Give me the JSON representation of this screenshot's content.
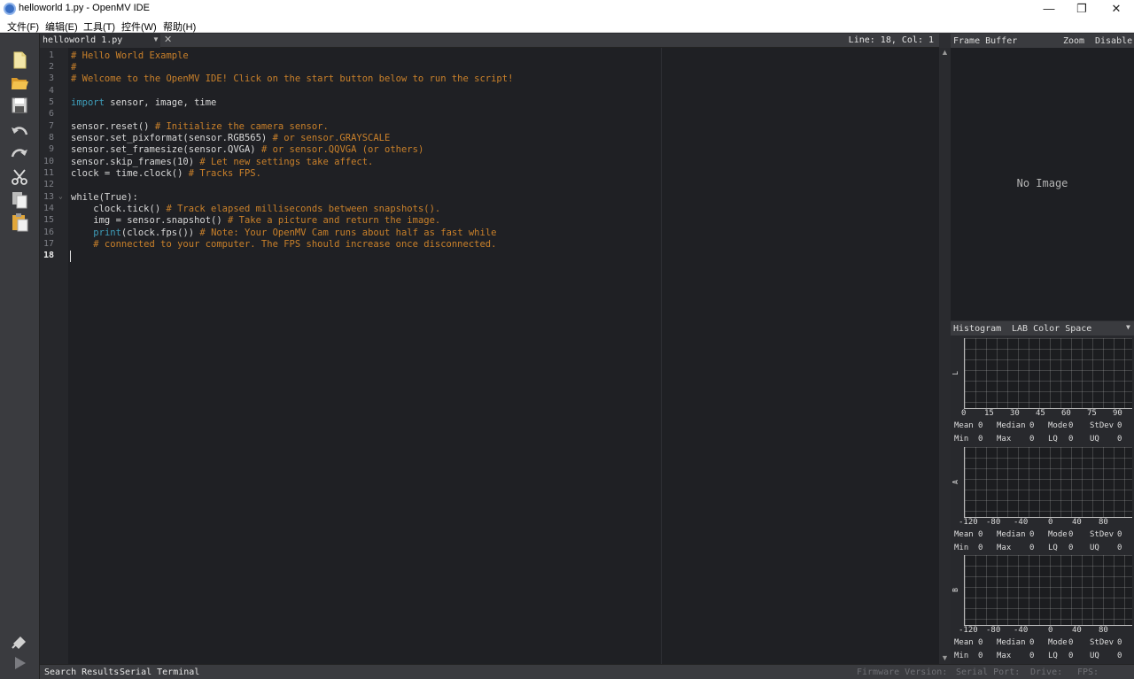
{
  "window": {
    "title": "helloworld 1.py - OpenMV IDE",
    "minimize": "—",
    "maximize": "❐",
    "close": "✕"
  },
  "menu": [
    "文件(F)",
    "编辑(E)",
    "工具(T)",
    "控件(W)",
    "帮助(H)"
  ],
  "editor": {
    "tab": {
      "label": "helloworld 1.py",
      "dropdown": "▼",
      "close": "✕"
    },
    "position": "Line: 18, Col: 1",
    "current_line": 18,
    "line_numbers": [
      "1",
      "2",
      "3",
      "4",
      "5",
      "6",
      "7",
      "8",
      "9",
      "10",
      "11",
      "12",
      "13",
      "14",
      "15",
      "16",
      "17",
      "18"
    ],
    "lines": {
      "l1": {
        "comment": "# Hello World Example"
      },
      "l2": {
        "comment": "#"
      },
      "l3": {
        "comment": "# Welcome to the OpenMV IDE! Click on the start button below to run the script!"
      },
      "l5": {
        "keyword": "import",
        "rest": " sensor, image, time"
      },
      "l7": {
        "code": "sensor.reset() ",
        "comment": "# Initialize the camera sensor."
      },
      "l8": {
        "code": "sensor.set_pixformat(sensor.RGB565) ",
        "comment": "# or sensor.GRAYSCALE"
      },
      "l9": {
        "code": "sensor.set_framesize(sensor.QVGA) ",
        "comment": "# or sensor.QQVGA (or others)"
      },
      "l10": {
        "code": "sensor.skip_frames(10) ",
        "comment": "# Let new settings take affect."
      },
      "l11": {
        "code": "clock = time.clock() ",
        "comment": "# Tracks FPS."
      },
      "l13": {
        "code": "while(True):"
      },
      "l14": {
        "code": "    clock.tick() ",
        "comment": "# Track elapsed milliseconds between snapshots()."
      },
      "l15": {
        "code": "    img = sensor.snapshot() ",
        "comment": "# Take a picture and return the image."
      },
      "l16": {
        "indent": "    ",
        "keyword": "print",
        "code": "(clock.fps()) ",
        "comment": "# Note: Your OpenMV Cam runs about half as fast while"
      },
      "l17": {
        "comment": "    # connected to your computer. The FPS should increase once disconnected."
      }
    },
    "fold_marker": "⌄"
  },
  "scrollbar": {
    "up": "▲",
    "down": "▼"
  },
  "frame_buffer": {
    "title": "Frame Buffer",
    "zoom": "Zoom",
    "disable": "Disable",
    "empty": "No Image"
  },
  "histogram": {
    "title": "Histogram",
    "color_space": "LAB Color Space",
    "dropdown": "▼",
    "channels": [
      {
        "axis": "L",
        "ticks": [
          "0",
          "15",
          "30",
          "45",
          "60",
          "75",
          "90"
        ],
        "stats_row1": [
          {
            "label": "Mean",
            "value": "0"
          },
          {
            "label": "Median",
            "value": "0"
          },
          {
            "label": "Mode",
            "value": "0"
          },
          {
            "label": "StDev",
            "value": "0"
          }
        ],
        "stats_row2": [
          {
            "label": "Min",
            "value": "0"
          },
          {
            "label": "Max",
            "value": "0"
          },
          {
            "label": "LQ",
            "value": "0"
          },
          {
            "label": "UQ",
            "value": "0"
          }
        ]
      },
      {
        "axis": "A",
        "ticks": [
          "-120",
          "-80",
          "-40",
          "0",
          "40",
          "80"
        ],
        "stats_row1": [
          {
            "label": "Mean",
            "value": "0"
          },
          {
            "label": "Median",
            "value": "0"
          },
          {
            "label": "Mode",
            "value": "0"
          },
          {
            "label": "StDev",
            "value": "0"
          }
        ],
        "stats_row2": [
          {
            "label": "Min",
            "value": "0"
          },
          {
            "label": "Max",
            "value": "0"
          },
          {
            "label": "LQ",
            "value": "0"
          },
          {
            "label": "UQ",
            "value": "0"
          }
        ]
      },
      {
        "axis": "B",
        "ticks": [
          "-120",
          "-80",
          "-40",
          "0",
          "40",
          "80"
        ],
        "stats_row1": [
          {
            "label": "Mean",
            "value": "0"
          },
          {
            "label": "Median",
            "value": "0"
          },
          {
            "label": "Mode",
            "value": "0"
          },
          {
            "label": "StDev",
            "value": "0"
          }
        ],
        "stats_row2": [
          {
            "label": "Min",
            "value": "0"
          },
          {
            "label": "Max",
            "value": "0"
          },
          {
            "label": "LQ",
            "value": "0"
          },
          {
            "label": "UQ",
            "value": "0"
          }
        ]
      }
    ]
  },
  "bottom_bar": {
    "search_results": "Search Results",
    "serial_terminal": "Serial Terminal",
    "firmware": "Firmware Version:",
    "serial_port": "Serial Port:",
    "drive": "Drive:",
    "fps": "FPS:"
  },
  "toolbar_icons": [
    "new-file-icon",
    "open-file-icon",
    "save-icon",
    "undo-icon",
    "redo-icon",
    "cut-icon",
    "copy-icon",
    "paste-icon",
    "connect-icon",
    "run-icon"
  ]
}
